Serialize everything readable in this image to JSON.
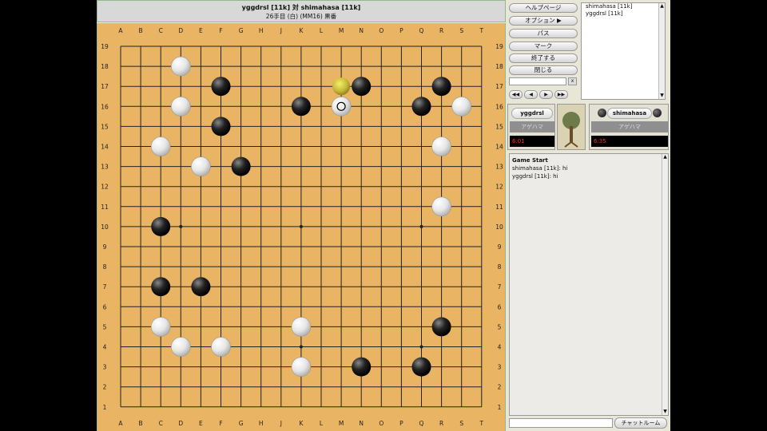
{
  "header": {
    "title": "yggdrsl [11k] 対 shimahasa [11k]",
    "status": "26手目 (白) (MM16) 黒番"
  },
  "board": {
    "size": 19,
    "col_labels": [
      "A",
      "B",
      "C",
      "D",
      "E",
      "F",
      "G",
      "H",
      "J",
      "K",
      "L",
      "M",
      "N",
      "O",
      "P",
      "Q",
      "R",
      "S",
      "T"
    ],
    "row_labels": [
      "19",
      "18",
      "17",
      "16",
      "15",
      "14",
      "13",
      "12",
      "11",
      "10",
      "9",
      "8",
      "7",
      "6",
      "5",
      "4",
      "3",
      "2",
      "1"
    ],
    "black_stones": [
      "F17",
      "N17",
      "R17",
      "K16",
      "Q16",
      "F15",
      "G13",
      "C10",
      "C7",
      "E7",
      "R5",
      "N3",
      "Q3"
    ],
    "white_stones": [
      "D18",
      "D16",
      "S16",
      "C14",
      "R14",
      "E13",
      "R11",
      "C5",
      "K5",
      "D4",
      "F4",
      "K3",
      "M16"
    ],
    "last_move": "M16",
    "hover_marker": "M17",
    "colors": {
      "board": "#e9b463",
      "line": "#222222"
    }
  },
  "controls": {
    "buttons": [
      "ヘルプページ",
      "オプション ▶",
      "パス",
      "マーク",
      "終了する",
      "閉じる"
    ],
    "nav": [
      "◀◀",
      "◀",
      "▶",
      "▶▶"
    ]
  },
  "player_list": [
    "shimahasa [11k]",
    "yggdrsl [11k]"
  ],
  "players": {
    "left": {
      "name": "yggdrsl",
      "agehama": "アゲハマ",
      "time": "6:01"
    },
    "right": {
      "name": "shimahasa",
      "agehama": "アゲハマ",
      "time": "6:35"
    }
  },
  "chat": {
    "lines": [
      "Game Start",
      "shimahasa [11k]: hi",
      "yggdrsl [11k]: hi"
    ],
    "send_label": "チャットルーム"
  }
}
